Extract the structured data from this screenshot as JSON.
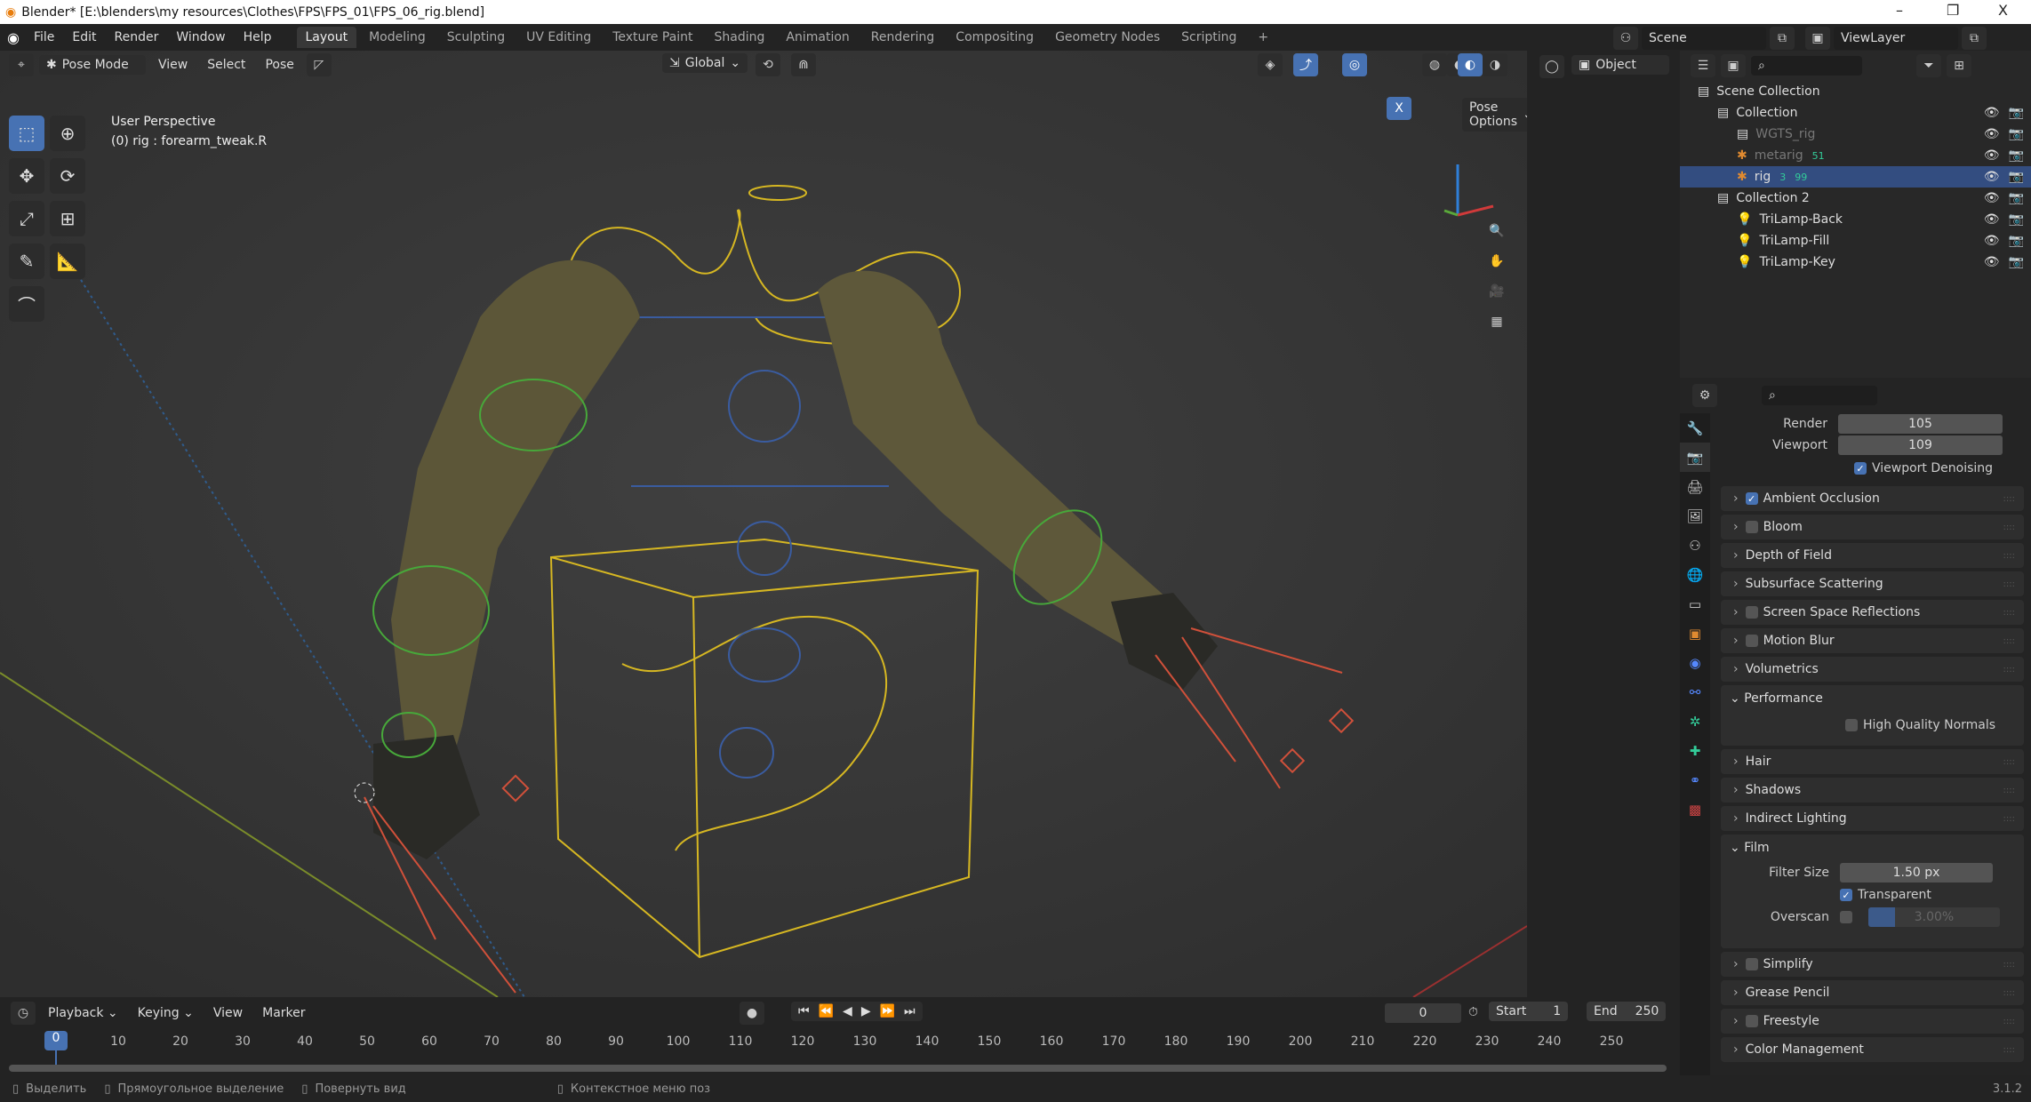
{
  "window": {
    "title": "Blender* [E:\\blenders\\my resources\\Clothes\\FPS\\FPS_01\\FPS_06_rig.blend]",
    "minimize": "–",
    "maximize": "❐",
    "close": "X"
  },
  "menu": [
    "File",
    "Edit",
    "Render",
    "Window",
    "Help"
  ],
  "workspaces": [
    "Layout",
    "Modeling",
    "Sculpting",
    "UV Editing",
    "Texture Paint",
    "Shading",
    "Animation",
    "Rendering",
    "Compositing",
    "Geometry Nodes",
    "Scripting",
    "+"
  ],
  "scene": {
    "name": "Scene",
    "view_layer": "ViewLayer"
  },
  "viewport_header": {
    "mode": "Pose Mode",
    "menus": [
      "View",
      "Select",
      "Pose"
    ],
    "orientation": "Global",
    "pose_options": "Pose Options",
    "x_mirror": "X",
    "object_mode": "Object"
  },
  "viewport": {
    "perspective": "User Perspective",
    "active": "(0) rig : forearm_tweak.R",
    "axes": {
      "x": "X",
      "y": "Y",
      "z": "Z"
    }
  },
  "outliner": {
    "items": [
      {
        "name": "Scene Collection",
        "level": 0
      },
      {
        "name": "Collection",
        "level": 1
      },
      {
        "name": "WGTS_rig",
        "level": 2
      },
      {
        "name": "metarig",
        "level": 2,
        "badge": "51"
      },
      {
        "name": "rig",
        "level": 2,
        "badge": "99",
        "badge2": "3",
        "selected": true
      },
      {
        "name": "Collection 2",
        "level": 1
      },
      {
        "name": "TriLamp-Back",
        "level": 2
      },
      {
        "name": "TriLamp-Fill",
        "level": 2
      },
      {
        "name": "TriLamp-Key",
        "level": 2
      }
    ]
  },
  "properties": {
    "samples": {
      "render_label": "Render",
      "render": "105",
      "viewport_label": "Viewport",
      "viewport": "109"
    },
    "viewport_denoising": "Viewport Denoising",
    "panels_top": [
      {
        "label": "Ambient Occlusion",
        "check": true
      },
      {
        "label": "Bloom",
        "check": false
      },
      {
        "label": "Depth of Field"
      },
      {
        "label": "Subsurface Scattering"
      },
      {
        "label": "Screen Space Reflections",
        "check": false
      },
      {
        "label": "Motion Blur",
        "check": false
      },
      {
        "label": "Volumetrics"
      }
    ],
    "performance": {
      "label": "Performance",
      "hqn": "High Quality Normals"
    },
    "panels_mid": [
      {
        "label": "Hair"
      },
      {
        "label": "Shadows"
      },
      {
        "label": "Indirect Lighting"
      }
    ],
    "film": {
      "label": "Film",
      "filter_label": "Filter Size",
      "filter": "1.50 px",
      "transparent": "Transparent",
      "overscan_label": "Overscan",
      "overscan": "3.00%",
      "overscan_fraction": 0.03
    },
    "panels_bottom": [
      {
        "label": "Simplify",
        "check": false
      },
      {
        "label": "Grease Pencil"
      },
      {
        "label": "Freestyle",
        "check": false
      },
      {
        "label": "Color Management"
      }
    ]
  },
  "timeline": {
    "menus": [
      "Playback",
      "Keying",
      "View",
      "Marker"
    ],
    "current": "0",
    "start_label": "Start",
    "start": "1",
    "end_label": "End",
    "end": "250",
    "frame_badge": "0",
    "ticks": [
      "10",
      "20",
      "30",
      "40",
      "50",
      "60",
      "70",
      "80",
      "90",
      "100",
      "110",
      "120",
      "130",
      "140",
      "150",
      "160",
      "170",
      "180",
      "190",
      "200",
      "210",
      "220",
      "230",
      "240",
      "250"
    ]
  },
  "status": {
    "items": [
      "Выделить",
      "Прямоугольное выделение",
      "Повернуть вид",
      "Контекстное меню поз"
    ],
    "version": "3.1.2"
  }
}
